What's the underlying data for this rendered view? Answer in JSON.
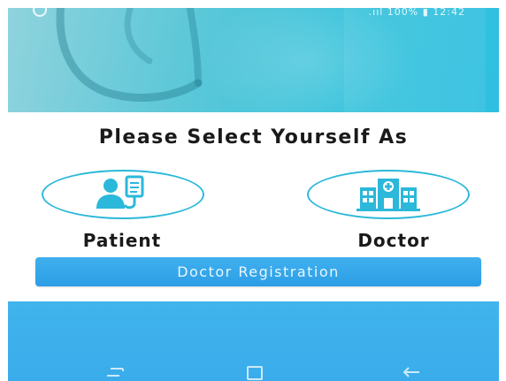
{
  "status_bar": {
    "right_text": ".ııl 100% ▮ 12:42"
  },
  "main": {
    "heading": "Please Select Yourself As",
    "roles": [
      {
        "label": "Patient",
        "icon": "patient-iv-icon"
      },
      {
        "label": "Doctor",
        "icon": "hospital-building-icon"
      }
    ],
    "register_button_label": "Doctor Registration"
  },
  "nav_bar": {
    "recent_icon": "recent-apps-icon",
    "home_icon": "home-icon",
    "back_icon": "back-arrow-icon"
  },
  "colors": {
    "accent": "#2bb8da",
    "button": "#2d9ee6",
    "bottom_bg": "#3aaceb",
    "hero_bg": "#39c3dc"
  }
}
